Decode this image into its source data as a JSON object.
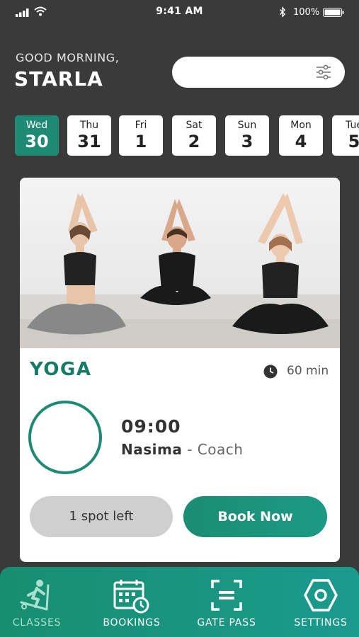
{
  "status_bar": {
    "time": "9:41 AM",
    "battery": "100%"
  },
  "greeting": {
    "subtitle": "GOOD MORNING,",
    "name": "STARLA"
  },
  "search": {
    "placeholder": ""
  },
  "dates": [
    {
      "day": "Wed",
      "num": "30",
      "active": true
    },
    {
      "day": "Thu",
      "num": "31"
    },
    {
      "day": "Fri",
      "num": "1"
    },
    {
      "day": "Sat",
      "num": "2"
    },
    {
      "day": "Sun",
      "num": "3"
    },
    {
      "day": "Mon",
      "num": "4"
    },
    {
      "day": "Tue",
      "num": "5"
    }
  ],
  "class_card": {
    "title": "YOGA",
    "duration": "60 min",
    "time": "09:00",
    "coach_name": "Nasima",
    "coach_sep": " - ",
    "coach_role": "Coach",
    "spots_label": "1 spot left",
    "book_label": "Book Now"
  },
  "bottom_nav": [
    {
      "label": "CLASSES",
      "icon": "treadmill-icon",
      "active": true
    },
    {
      "label": "BOOKINGS",
      "icon": "calendar-clock-icon"
    },
    {
      "label": "GATE PASS",
      "icon": "scan-icon"
    },
    {
      "label": "SETTINGS",
      "icon": "hexagon-settings-icon"
    }
  ],
  "colors": {
    "accent": "#1e8a73",
    "background": "#3a3a3a",
    "card": "#ffffff"
  }
}
